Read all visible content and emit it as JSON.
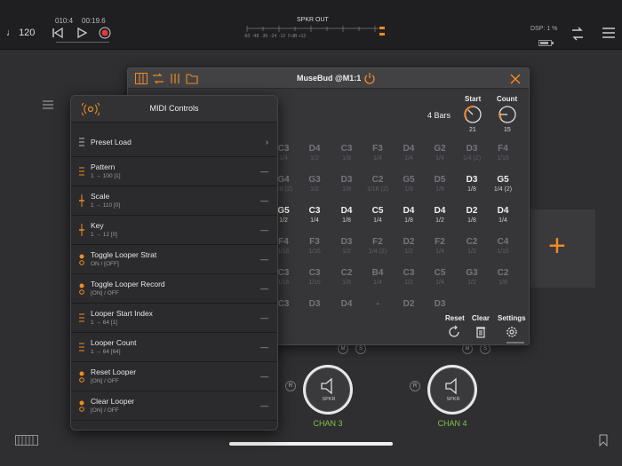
{
  "topbar": {
    "tempo_icon": "note-icon",
    "tempo": "120",
    "position": "010:4",
    "time": "00:19.6",
    "meter_label": "SPKR OUT",
    "meter_scale": "-60  -48  -36  -24  -12  0 dB +12",
    "dsp": "DSP: 1 %",
    "battery_icon": "battery-icon"
  },
  "plugin": {
    "title": "MuseBud @M1:1",
    "bars": "4 Bars",
    "start_label": "Start",
    "start_value": "21",
    "count_label": "Count",
    "count_value": "15",
    "reset_label": "Reset",
    "clear_label": "Clear",
    "settings_label": "Settings",
    "grid": [
      [
        [
          "C3",
          "1/4",
          0
        ],
        [
          "D4",
          "1/2",
          0
        ],
        [
          "C3",
          "1/8",
          0
        ],
        [
          "F3",
          "1/4",
          0
        ],
        [
          "D4",
          "1/4",
          0
        ],
        [
          "G2",
          "1/4",
          0
        ],
        [
          "D3",
          "1/4 (2)",
          0
        ],
        [
          "F4",
          "1/16",
          0
        ]
      ],
      [
        [
          "G4",
          "1/8 (2)",
          0
        ],
        [
          "G3",
          "1/2",
          0
        ],
        [
          "D3",
          "1/8",
          0
        ],
        [
          "C2",
          "1/16 (2)",
          0
        ],
        [
          "G5",
          "1/8",
          0
        ],
        [
          "D5",
          "1/8",
          0
        ],
        [
          "D3",
          "1/8",
          1
        ],
        [
          "G5",
          "1/4 (2)",
          1
        ]
      ],
      [
        [
          "G5",
          "1/2",
          1
        ],
        [
          "C3",
          "1/4",
          1
        ],
        [
          "D4",
          "1/8",
          1
        ],
        [
          "C5",
          "1/4",
          1
        ],
        [
          "D4",
          "1/8",
          1
        ],
        [
          "D4",
          "1/2",
          1
        ],
        [
          "D2",
          "1/8",
          1
        ],
        [
          "D4",
          "1/4",
          1
        ]
      ],
      [
        [
          "F4",
          "1/16",
          0
        ],
        [
          "F3",
          "1/16",
          0
        ],
        [
          "D3",
          "1/2",
          0
        ],
        [
          "F2",
          "1/4 (2)",
          0
        ],
        [
          "D2",
          "1/2",
          0
        ],
        [
          "F2",
          "1/4",
          0
        ],
        [
          "C2",
          "1/2",
          0
        ],
        [
          "C4",
          "1/16",
          0
        ]
      ],
      [
        [
          "C3",
          "1/16",
          0
        ],
        [
          "C3",
          "1/16",
          0
        ],
        [
          "C2",
          "1/8",
          0
        ],
        [
          "B4",
          "1/4",
          0
        ],
        [
          "C3",
          "1/2",
          0
        ],
        [
          "C5",
          "1/4",
          0
        ],
        [
          "G3",
          "1/2",
          0
        ],
        [
          "C2",
          "1/8",
          0
        ]
      ],
      [
        [
          "C3",
          "",
          0
        ],
        [
          "D3",
          "",
          0
        ],
        [
          "D4",
          "",
          0
        ],
        [
          "-",
          "",
          0
        ],
        [
          "D2",
          "",
          0
        ],
        [
          "D3",
          "",
          0
        ],
        [
          "",
          ""
        ],
        [
          "",
          ""
        ]
      ]
    ]
  },
  "midi": {
    "title": "MIDI Controls",
    "rows": [
      {
        "title": "Preset Load",
        "sub": "",
        "right": "›"
      },
      {
        "title": "Pattern",
        "sub": "1 → 100 [1]",
        "right": "—"
      },
      {
        "title": "Scale",
        "sub": "1 → 110  [0]",
        "right": "—"
      },
      {
        "title": "Key",
        "sub": "1 → 12  [0]",
        "right": "—"
      },
      {
        "title": "Toggle Looper Strat",
        "sub": "ON / [OFF]",
        "right": "—"
      },
      {
        "title": "Toggle Looper Record",
        "sub": "[ON] / OFF",
        "right": "—"
      },
      {
        "title": "Looper Start Index",
        "sub": "1 → 64 [1]",
        "right": "—"
      },
      {
        "title": "Looper Count",
        "sub": "1 → 64 [64]",
        "right": "—"
      },
      {
        "title": "Reset Looper",
        "sub": "[ON] / OFF",
        "right": "—"
      },
      {
        "title": "Clear Looper",
        "sub": "[ON] / OFF",
        "right": "—"
      }
    ]
  },
  "channels": {
    "chan3": "CHAN 3",
    "chan4": "CHAN 4",
    "spkr": "SPKR",
    "m": "M",
    "s": "S",
    "r": "R"
  },
  "colors": {
    "accent_orange": "#f08a24",
    "green": "#7fc34a",
    "bg": "#2f2f31"
  }
}
